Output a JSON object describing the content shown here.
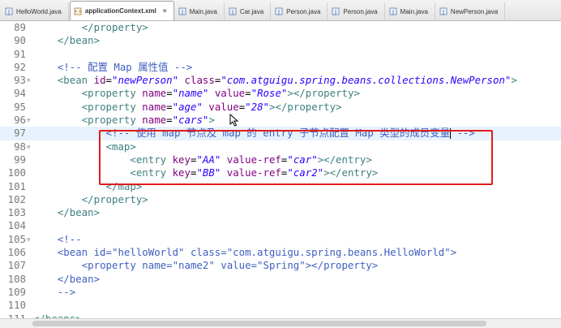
{
  "tabs": [
    {
      "label": "HelloWorld.java",
      "icon": "java-file-icon",
      "active": false
    },
    {
      "label": "applicationContext.xml",
      "icon": "xml-file-icon",
      "active": true
    },
    {
      "label": "Main.java",
      "icon": "java-file-icon",
      "active": false
    },
    {
      "label": "Car.java",
      "icon": "java-file-icon",
      "active": false
    },
    {
      "label": "Person.java",
      "icon": "java-file-icon",
      "active": false
    },
    {
      "label": "Person.java",
      "icon": "java-file-icon",
      "active": false
    },
    {
      "label": "Main.java",
      "icon": "java-file-icon",
      "active": false
    },
    {
      "label": "NewPerson.java",
      "icon": "java-file-icon",
      "active": false
    }
  ],
  "tab_close_glyph": "×",
  "current_line": 97,
  "lines": [
    {
      "n": "89",
      "fold": "",
      "indent": "        ",
      "tokens": [
        [
          "tg",
          "</property>"
        ]
      ]
    },
    {
      "n": "90",
      "fold": "",
      "indent": "    ",
      "tokens": [
        [
          "tg",
          "</bean>"
        ]
      ]
    },
    {
      "n": "91",
      "fold": "",
      "indent": "",
      "tokens": []
    },
    {
      "n": "92",
      "fold": "",
      "indent": "    ",
      "tokens": [
        [
          "cm",
          "<!-- 配置 Map 属性值 -->"
        ]
      ]
    },
    {
      "n": "93",
      "fold": "⊖",
      "indent": "    ",
      "tokens": [
        [
          "tg",
          "<bean "
        ],
        [
          "an",
          "id"
        ],
        [
          "pl",
          "="
        ],
        [
          "av",
          "\"newPerson\""
        ],
        [
          "pl",
          " "
        ],
        [
          "an",
          "class"
        ],
        [
          "pl",
          "="
        ],
        [
          "av",
          "\"com.atguigu.spring.beans.collections.NewPerson\""
        ],
        [
          "tg",
          ">"
        ]
      ]
    },
    {
      "n": "94",
      "fold": "",
      "indent": "        ",
      "tokens": [
        [
          "tg",
          "<property "
        ],
        [
          "an",
          "name"
        ],
        [
          "pl",
          "="
        ],
        [
          "av",
          "\"name\""
        ],
        [
          "pl",
          " "
        ],
        [
          "an",
          "value"
        ],
        [
          "pl",
          "="
        ],
        [
          "av",
          "\"Rose\""
        ],
        [
          "tg",
          "></property>"
        ]
      ]
    },
    {
      "n": "95",
      "fold": "",
      "indent": "        ",
      "tokens": [
        [
          "tg",
          "<property "
        ],
        [
          "an",
          "name"
        ],
        [
          "pl",
          "="
        ],
        [
          "av",
          "\"age\""
        ],
        [
          "pl",
          " "
        ],
        [
          "an",
          "value"
        ],
        [
          "pl",
          "="
        ],
        [
          "av",
          "\"28\""
        ],
        [
          "tg",
          "></property>"
        ]
      ]
    },
    {
      "n": "96",
      "fold": "⊖",
      "indent": "        ",
      "tokens": [
        [
          "tg",
          "<property "
        ],
        [
          "an",
          "name"
        ],
        [
          "pl",
          "="
        ],
        [
          "av",
          "\"cars\""
        ],
        [
          "tg",
          ">"
        ]
      ]
    },
    {
      "n": "97",
      "fold": "",
      "indent": "            ",
      "tokens": [
        [
          "cm",
          "<!-- 使用 map 节点及 map 的 entry 子节点配置 Map 类型的成员变量"
        ],
        [
          "caret",
          ""
        ],
        [
          "cm",
          " -->"
        ]
      ]
    },
    {
      "n": "98",
      "fold": "⊖",
      "indent": "            ",
      "tokens": [
        [
          "tg",
          "<map>"
        ]
      ]
    },
    {
      "n": "99",
      "fold": "",
      "indent": "                ",
      "tokens": [
        [
          "tg",
          "<entry "
        ],
        [
          "an",
          "key"
        ],
        [
          "pl",
          "="
        ],
        [
          "av",
          "\"AA\""
        ],
        [
          "pl",
          " "
        ],
        [
          "an",
          "value-ref"
        ],
        [
          "pl",
          "="
        ],
        [
          "av",
          "\"car\""
        ],
        [
          "tg",
          "></entry>"
        ]
      ]
    },
    {
      "n": "100",
      "fold": "",
      "indent": "                ",
      "tokens": [
        [
          "tg",
          "<entry "
        ],
        [
          "an",
          "key"
        ],
        [
          "pl",
          "="
        ],
        [
          "av",
          "\"BB\""
        ],
        [
          "pl",
          " "
        ],
        [
          "an",
          "value-ref"
        ],
        [
          "pl",
          "="
        ],
        [
          "av",
          "\"car2\""
        ],
        [
          "tg",
          "></entry>"
        ]
      ]
    },
    {
      "n": "101",
      "fold": "",
      "indent": "            ",
      "tokens": [
        [
          "tg",
          "</map>"
        ]
      ]
    },
    {
      "n": "102",
      "fold": "",
      "indent": "        ",
      "tokens": [
        [
          "tg",
          "</property>"
        ]
      ]
    },
    {
      "n": "103",
      "fold": "",
      "indent": "    ",
      "tokens": [
        [
          "tg",
          "</bean>"
        ]
      ]
    },
    {
      "n": "104",
      "fold": "",
      "indent": "",
      "tokens": []
    },
    {
      "n": "105",
      "fold": "⊖",
      "indent": "    ",
      "tokens": [
        [
          "cm",
          "<!--"
        ]
      ]
    },
    {
      "n": "106",
      "fold": "",
      "indent": "    ",
      "tokens": [
        [
          "cm",
          "<bean id=\"helloWorld\" class=\"com.atguigu.spring.beans.HelloWorld\">"
        ]
      ]
    },
    {
      "n": "107",
      "fold": "",
      "indent": "        ",
      "tokens": [
        [
          "cm",
          "<property name=\"name2\" value=\"Spring\"></property>"
        ]
      ]
    },
    {
      "n": "108",
      "fold": "",
      "indent": "    ",
      "tokens": [
        [
          "cm",
          "</bean>"
        ]
      ]
    },
    {
      "n": "109",
      "fold": "",
      "indent": "    ",
      "tokens": [
        [
          "cm",
          "-->"
        ]
      ]
    },
    {
      "n": "110",
      "fold": "",
      "indent": "",
      "tokens": []
    },
    {
      "n": "111",
      "fold": "",
      "indent": "",
      "tokens": [
        [
          "tg",
          "</beans>"
        ]
      ]
    }
  ],
  "colors": {
    "tag": "#3f7f7f",
    "attribute_name": "#7f007f",
    "attribute_value": "#2a00ff",
    "comment": "#3f5fbf",
    "highlight_box": "#e21b1b",
    "current_line_bg": "#e8f2fe"
  }
}
